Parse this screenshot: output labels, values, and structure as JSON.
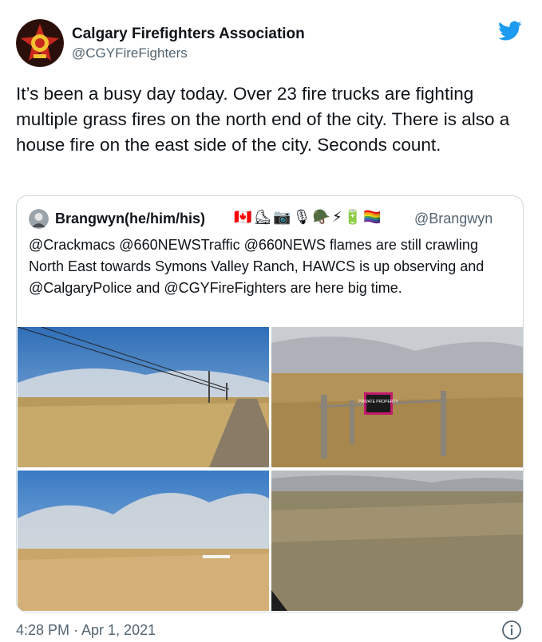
{
  "author": {
    "name": "Calgary Firefighters Association",
    "handle": "@CGYFireFighters",
    "avatar_icon": "firefighter-badge-icon"
  },
  "tweet": {
    "text": "It’s been a busy day today. Over 23 fire trucks are fighting multiple grass fires on the north end of the city. There is also a house fire on the east side of the city. Seconds count.",
    "timestamp": "4:28 PM · Apr 1, 2021"
  },
  "quoted_tweet": {
    "name": "Brangwyn(he/him/his)",
    "emoji": "🇨🇦⛸📷🎙🪖⚡🔋🏳️‍🌈",
    "handle": "@Brangwyn",
    "text": "@Crackmacs @660NEWSTraffic @660NEWS flames are still crawling North East towards Symons Valley Ranch, HAWCS is up observing and @CalgaryPolice and @CGYFireFighters are here big time."
  },
  "photos": [
    {
      "sign_text": ""
    },
    {
      "sign_text": "PRIVATE PROPERTY"
    },
    {
      "sign_text": ""
    },
    {
      "sign_text": ""
    }
  ],
  "colors": {
    "text": "#0f1419",
    "secondary": "#536471",
    "twitter_blue": "#1d9bf0",
    "border": "#cfd9de"
  }
}
